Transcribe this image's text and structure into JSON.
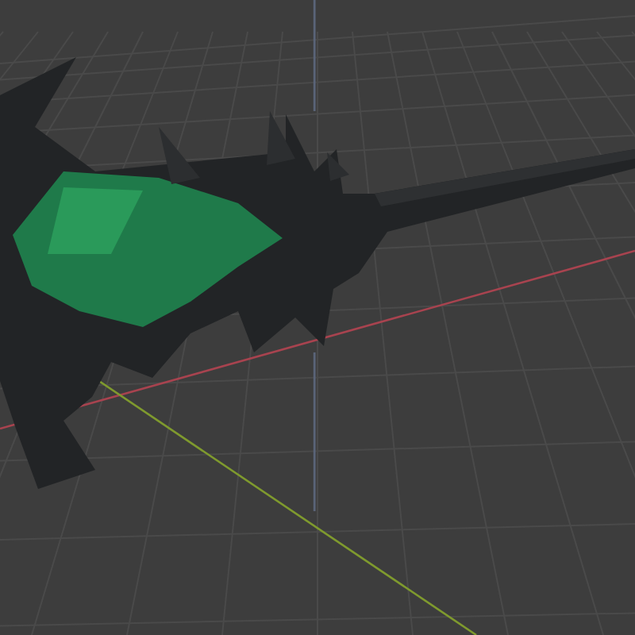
{
  "viewport": {
    "axes": [
      {
        "kind": "x",
        "color": "#a8434f"
      },
      {
        "kind": "y",
        "color": "#7f9a2e"
      },
      {
        "kind": "z",
        "color": "#5a6478"
      }
    ]
  }
}
